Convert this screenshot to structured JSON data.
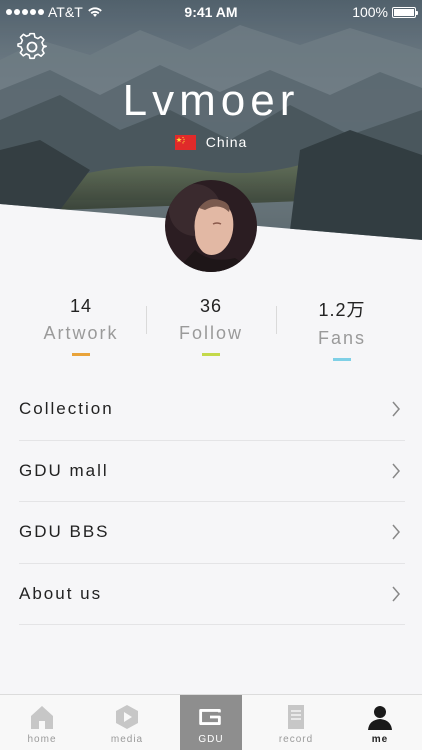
{
  "status_bar": {
    "carrier": "AT&T",
    "time": "9:41 AM",
    "battery": "100%",
    "battery_level": 1.0
  },
  "profile": {
    "name": "Lvmoer",
    "country": "China"
  },
  "stats": [
    {
      "value": "14",
      "label": "Artwork",
      "color": "#e9a33a"
    },
    {
      "value": "36",
      "label": "Follow",
      "color": "#c4d94a"
    },
    {
      "value": "1.2万",
      "label": "Fans",
      "color": "#7fd0e6"
    }
  ],
  "menu": [
    {
      "label": "Collection"
    },
    {
      "label": "GDU mall"
    },
    {
      "label": "GDU BBS"
    },
    {
      "label": "About us"
    }
  ],
  "tabbar": {
    "active": "me",
    "tabs": [
      {
        "id": "home",
        "label": "home",
        "icon": "home-icon"
      },
      {
        "id": "media",
        "label": "media",
        "icon": "play-icon"
      },
      {
        "id": "gdu",
        "label": "GDU",
        "icon": "gdu-logo-icon"
      },
      {
        "id": "record",
        "label": "record",
        "icon": "document-icon"
      },
      {
        "id": "me",
        "label": "me",
        "icon": "person-icon"
      }
    ]
  },
  "colors": {
    "background": "#f6f6f8",
    "tab_active": "#222222",
    "tab_inactive": "#9a9a9a",
    "gdu_tab_bg": "#8e8e8e"
  }
}
